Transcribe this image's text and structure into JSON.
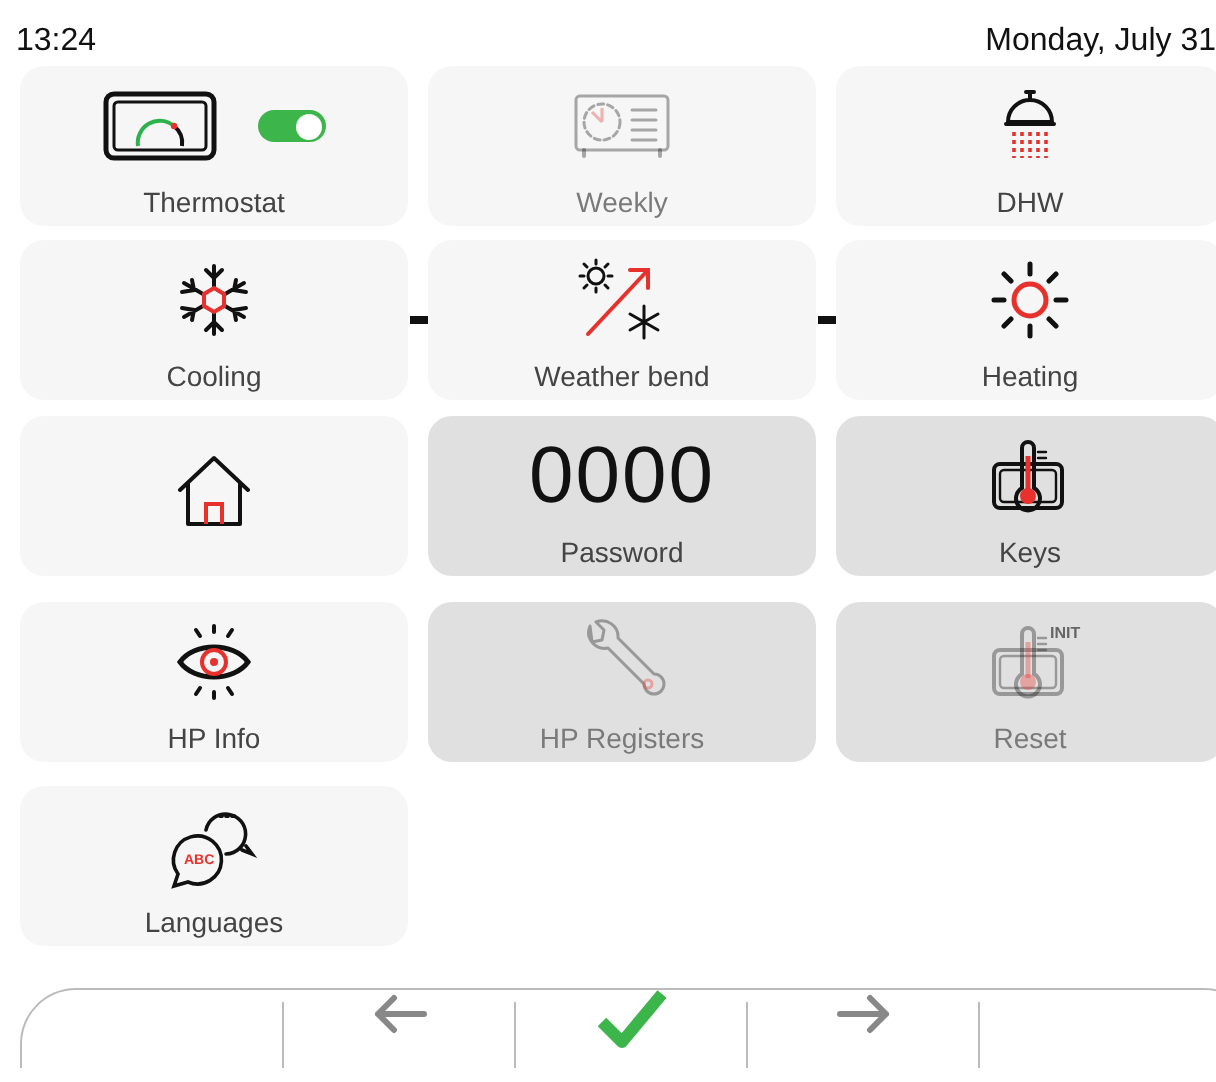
{
  "status_bar": {
    "time": "13:24",
    "date": "Monday, July 31"
  },
  "rows": [
    {
      "tiles": [
        {
          "kind": "thermostat",
          "label": "Thermostat",
          "disabled": false,
          "shaded": false,
          "toggle_on": true
        },
        {
          "kind": "weekly",
          "label": "Weekly",
          "disabled": true,
          "shaded": false
        },
        {
          "kind": "shower",
          "label": "DHW",
          "disabled": false,
          "shaded": false
        }
      ]
    },
    {
      "linked": true,
      "tiles": [
        {
          "kind": "snowflake",
          "label": "Cooling",
          "disabled": false,
          "shaded": false
        },
        {
          "kind": "curve",
          "label": "Weather bend",
          "disabled": false,
          "shaded": false
        },
        {
          "kind": "sun",
          "label": "Heating",
          "disabled": false,
          "shaded": false
        }
      ]
    },
    {
      "tiles": [
        {
          "kind": "home",
          "disabled": false,
          "shaded": false
        },
        {
          "kind": "code",
          "value": "0000",
          "label": "Password",
          "disabled": false,
          "shaded": true
        },
        {
          "kind": "probe",
          "label": "Keys",
          "disabled": false,
          "shaded": true
        }
      ]
    },
    {
      "tiles": [
        {
          "kind": "eye",
          "label": "HP Info",
          "disabled": false,
          "shaded": false
        },
        {
          "kind": "wrench",
          "label": "HP Registers",
          "disabled": true,
          "shaded": true
        },
        {
          "kind": "probe",
          "badge": "INIT",
          "label": "Reset",
          "disabled": true,
          "shaded": true
        }
      ]
    },
    {
      "tiles": [
        {
          "kind": "chat",
          "badge": "ABC",
          "label": "Languages",
          "disabled": false,
          "shaded": false
        }
      ]
    }
  ],
  "nav": [
    {
      "kind": "blank"
    },
    {
      "kind": "back"
    },
    {
      "kind": "confirm"
    },
    {
      "kind": "forward"
    },
    {
      "kind": "blank"
    }
  ]
}
